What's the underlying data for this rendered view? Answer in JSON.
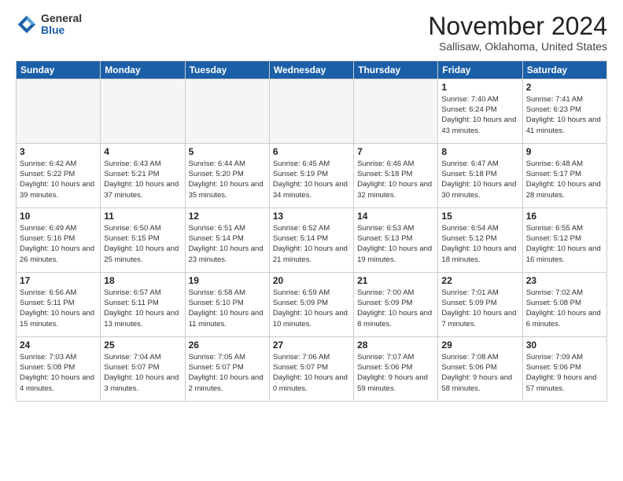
{
  "logo": {
    "general": "General",
    "blue": "Blue"
  },
  "title": "November 2024",
  "location": "Sallisaw, Oklahoma, United States",
  "weekdays": [
    "Sunday",
    "Monday",
    "Tuesday",
    "Wednesday",
    "Thursday",
    "Friday",
    "Saturday"
  ],
  "weeks": [
    [
      {
        "day": "",
        "info": ""
      },
      {
        "day": "",
        "info": ""
      },
      {
        "day": "",
        "info": ""
      },
      {
        "day": "",
        "info": ""
      },
      {
        "day": "",
        "info": ""
      },
      {
        "day": "1",
        "info": "Sunrise: 7:40 AM\nSunset: 6:24 PM\nDaylight: 10 hours and 43 minutes."
      },
      {
        "day": "2",
        "info": "Sunrise: 7:41 AM\nSunset: 6:23 PM\nDaylight: 10 hours and 41 minutes."
      }
    ],
    [
      {
        "day": "3",
        "info": "Sunrise: 6:42 AM\nSunset: 5:22 PM\nDaylight: 10 hours and 39 minutes."
      },
      {
        "day": "4",
        "info": "Sunrise: 6:43 AM\nSunset: 5:21 PM\nDaylight: 10 hours and 37 minutes."
      },
      {
        "day": "5",
        "info": "Sunrise: 6:44 AM\nSunset: 5:20 PM\nDaylight: 10 hours and 35 minutes."
      },
      {
        "day": "6",
        "info": "Sunrise: 6:45 AM\nSunset: 5:19 PM\nDaylight: 10 hours and 34 minutes."
      },
      {
        "day": "7",
        "info": "Sunrise: 6:46 AM\nSunset: 5:18 PM\nDaylight: 10 hours and 32 minutes."
      },
      {
        "day": "8",
        "info": "Sunrise: 6:47 AM\nSunset: 5:18 PM\nDaylight: 10 hours and 30 minutes."
      },
      {
        "day": "9",
        "info": "Sunrise: 6:48 AM\nSunset: 5:17 PM\nDaylight: 10 hours and 28 minutes."
      }
    ],
    [
      {
        "day": "10",
        "info": "Sunrise: 6:49 AM\nSunset: 5:16 PM\nDaylight: 10 hours and 26 minutes."
      },
      {
        "day": "11",
        "info": "Sunrise: 6:50 AM\nSunset: 5:15 PM\nDaylight: 10 hours and 25 minutes."
      },
      {
        "day": "12",
        "info": "Sunrise: 6:51 AM\nSunset: 5:14 PM\nDaylight: 10 hours and 23 minutes."
      },
      {
        "day": "13",
        "info": "Sunrise: 6:52 AM\nSunset: 5:14 PM\nDaylight: 10 hours and 21 minutes."
      },
      {
        "day": "14",
        "info": "Sunrise: 6:53 AM\nSunset: 5:13 PM\nDaylight: 10 hours and 19 minutes."
      },
      {
        "day": "15",
        "info": "Sunrise: 6:54 AM\nSunset: 5:12 PM\nDaylight: 10 hours and 18 minutes."
      },
      {
        "day": "16",
        "info": "Sunrise: 6:55 AM\nSunset: 5:12 PM\nDaylight: 10 hours and 16 minutes."
      }
    ],
    [
      {
        "day": "17",
        "info": "Sunrise: 6:56 AM\nSunset: 5:11 PM\nDaylight: 10 hours and 15 minutes."
      },
      {
        "day": "18",
        "info": "Sunrise: 6:57 AM\nSunset: 5:11 PM\nDaylight: 10 hours and 13 minutes."
      },
      {
        "day": "19",
        "info": "Sunrise: 6:58 AM\nSunset: 5:10 PM\nDaylight: 10 hours and 11 minutes."
      },
      {
        "day": "20",
        "info": "Sunrise: 6:59 AM\nSunset: 5:09 PM\nDaylight: 10 hours and 10 minutes."
      },
      {
        "day": "21",
        "info": "Sunrise: 7:00 AM\nSunset: 5:09 PM\nDaylight: 10 hours and 8 minutes."
      },
      {
        "day": "22",
        "info": "Sunrise: 7:01 AM\nSunset: 5:09 PM\nDaylight: 10 hours and 7 minutes."
      },
      {
        "day": "23",
        "info": "Sunrise: 7:02 AM\nSunset: 5:08 PM\nDaylight: 10 hours and 6 minutes."
      }
    ],
    [
      {
        "day": "24",
        "info": "Sunrise: 7:03 AM\nSunset: 5:08 PM\nDaylight: 10 hours and 4 minutes."
      },
      {
        "day": "25",
        "info": "Sunrise: 7:04 AM\nSunset: 5:07 PM\nDaylight: 10 hours and 3 minutes."
      },
      {
        "day": "26",
        "info": "Sunrise: 7:05 AM\nSunset: 5:07 PM\nDaylight: 10 hours and 2 minutes."
      },
      {
        "day": "27",
        "info": "Sunrise: 7:06 AM\nSunset: 5:07 PM\nDaylight: 10 hours and 0 minutes."
      },
      {
        "day": "28",
        "info": "Sunrise: 7:07 AM\nSunset: 5:06 PM\nDaylight: 9 hours and 59 minutes."
      },
      {
        "day": "29",
        "info": "Sunrise: 7:08 AM\nSunset: 5:06 PM\nDaylight: 9 hours and 58 minutes."
      },
      {
        "day": "30",
        "info": "Sunrise: 7:09 AM\nSunset: 5:06 PM\nDaylight: 9 hours and 57 minutes."
      }
    ]
  ]
}
